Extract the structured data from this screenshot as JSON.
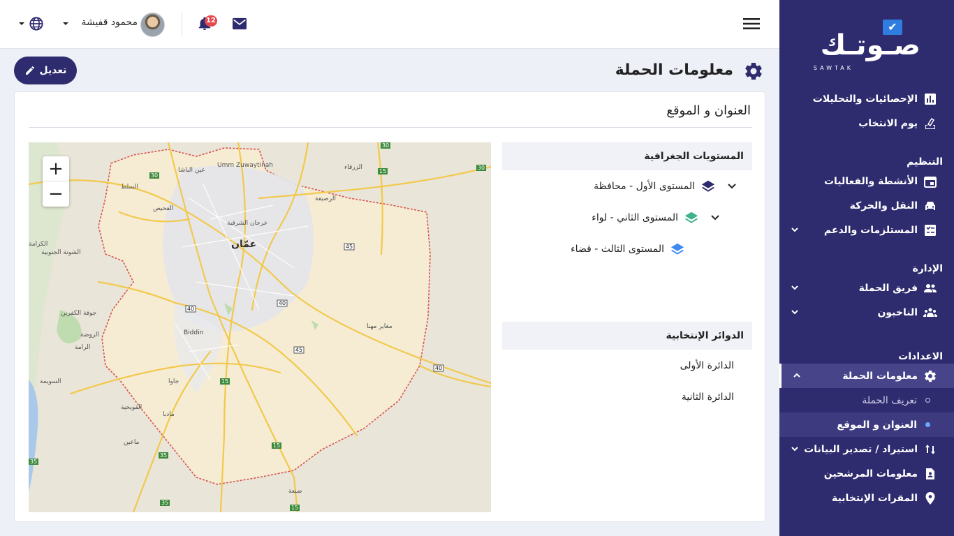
{
  "brand": {
    "name": "صـوتـك",
    "sub": "SAWTAK"
  },
  "topbar": {
    "username": "محمود قفيشة",
    "notification_count": "12"
  },
  "page": {
    "title": "معلومات الحملة",
    "edit_label": "تعديل",
    "card_title": "العنوان و الموقع"
  },
  "geo": {
    "heading": "المستويات الجغرافية",
    "levels": [
      {
        "label": "المستوى الأول - محافظة"
      },
      {
        "label": "المستوى الثاني - لواء"
      },
      {
        "label": "المستوى الثالث - قضاء"
      }
    ]
  },
  "districts": {
    "heading": "الدوائر الإنتخابية",
    "items": [
      "الدائرة الأولى",
      "الدائرة الثانية"
    ]
  },
  "map": {
    "labels": {
      "amman": "عمّان",
      "zarqa": "الزرقاء",
      "russeifa": "الرصيفة",
      "umm_zuwaytinah": "Umm Zuwaytinah",
      "biddin": "Biddin",
      "wadi_sir": "عرجان الشرقية",
      "mughayir": "مغاير مهنا",
      "salt": "السلط",
      "ain_basha": "عين الباشا",
      "fuhais": "الفحيص",
      "karama": "الكرامة",
      "shuna": "الشونة الجنوبية",
      "kafrain": "جوفة الكفرين",
      "rawda": "الروضة",
      "rama": "الرامة",
      "suwaymah": "السويمة",
      "fuhays2": "الفويحية",
      "madaba": "مادبا",
      "maain": "ماعين",
      "dhiba": "ضبعة",
      "jawa": "جاوا"
    },
    "road_shields": [
      "30",
      "15",
      "45",
      "40",
      "40",
      "45",
      "40",
      "15",
      "35",
      "15",
      "35",
      "35",
      "30",
      "15"
    ]
  },
  "sidebar": {
    "items": [
      {
        "label": "الإحصائيات والتحليلات",
        "icon": "chart-icon"
      },
      {
        "label": "يوم الانتخاب",
        "icon": "ballot-icon"
      }
    ],
    "sections": {
      "organization": "التنظيم",
      "management": "الإدارة",
      "settings": "الاعدادات"
    },
    "org_items": [
      {
        "label": "الأنشطة والفعاليات",
        "icon": "calendar-icon",
        "has_caret": false
      },
      {
        "label": "النقل والحركة",
        "icon": "car-icon",
        "has_caret": false
      },
      {
        "label": "المستلزمات والدعم",
        "icon": "checklist-icon",
        "has_caret": true
      }
    ],
    "mgmt_items": [
      {
        "label": "فريق الحملة",
        "icon": "team-icon",
        "has_caret": true
      },
      {
        "label": "الناخبون",
        "icon": "voters-icon",
        "has_caret": true
      }
    ],
    "settings_items": {
      "campaign_info": "معلومات الحملة",
      "campaign_def": "تعريف الحملة",
      "address_location": "العنوان و الموقع",
      "import_export": "استيراد / تصدير البيانات",
      "candidates": "معلومات المرشحين",
      "offices": "المقرات الإنتخابية"
    }
  },
  "colors": {
    "sidebar_bg": "#2e2b6e",
    "accent": "#2f7de1",
    "badge": "#e5484d",
    "level1": "#2e2b6e",
    "level2": "#3fb38b",
    "level3": "#3d8bf2"
  }
}
